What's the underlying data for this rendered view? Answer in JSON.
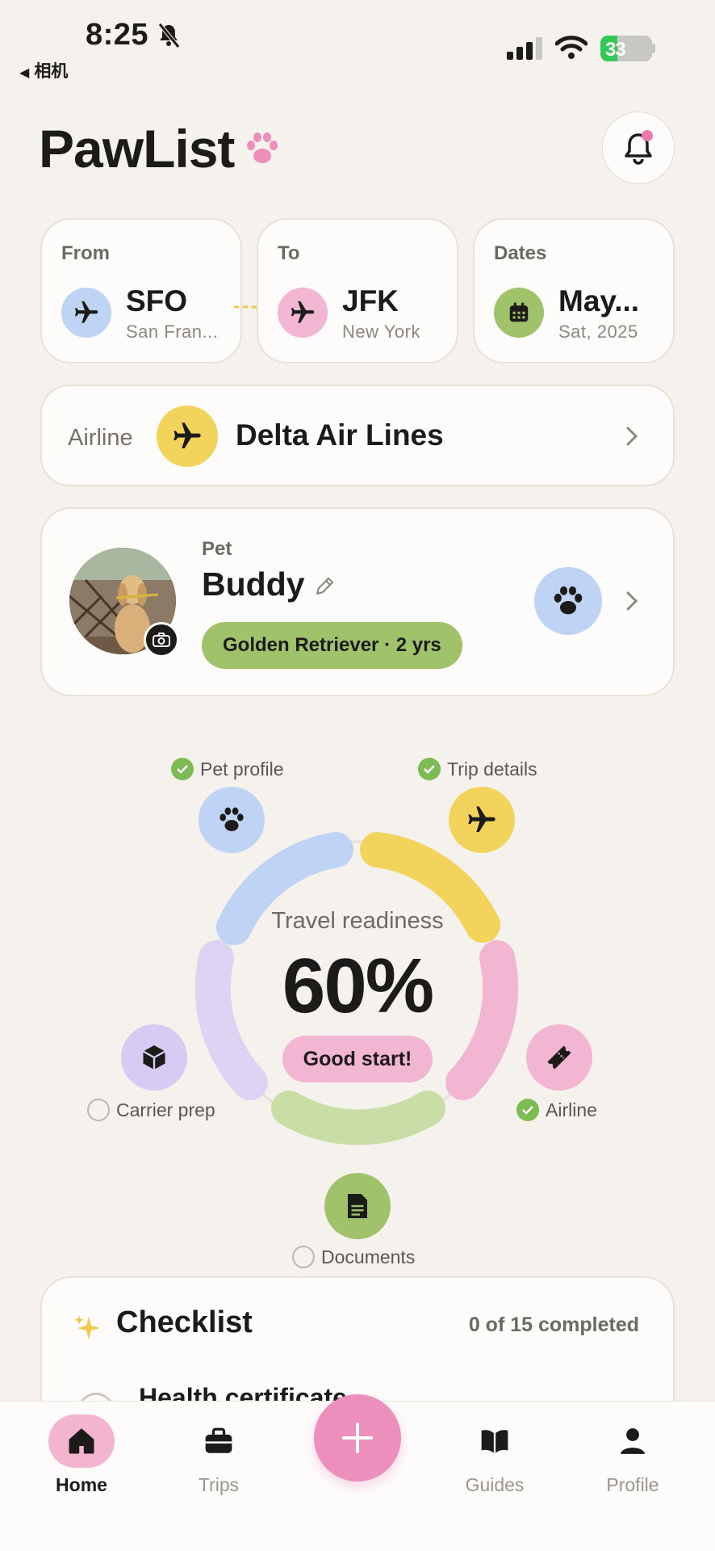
{
  "status_bar": {
    "time": "8:25",
    "back_label": "相机",
    "battery": "33"
  },
  "header": {
    "title": "PawList"
  },
  "route": {
    "from": {
      "label": "From",
      "code": "SFO",
      "city": "San Fran..."
    },
    "to": {
      "label": "To",
      "code": "JFK",
      "city": "New York"
    },
    "dates": {
      "label": "Dates",
      "value": "May...",
      "sub": "Sat, 2025"
    }
  },
  "airline": {
    "label": "Airline",
    "name": "Delta Air Lines"
  },
  "pet": {
    "label": "Pet",
    "name": "Buddy",
    "breed": "Golden Retriever · 2 yrs"
  },
  "readiness": {
    "title": "Travel readiness",
    "percent": "60%",
    "status": "Good start!",
    "steps": [
      {
        "label": "Pet profile",
        "done": true
      },
      {
        "label": "Trip details",
        "done": true
      },
      {
        "label": "Airline",
        "done": true
      },
      {
        "label": "Documents",
        "done": false
      },
      {
        "label": "Carrier prep",
        "done": false
      }
    ]
  },
  "checklist": {
    "title": "Checklist",
    "count": "0 of 15 completed",
    "first_item": "Health certificate"
  },
  "tabs": [
    {
      "label": "Home",
      "icon": "home-icon",
      "active": true
    },
    {
      "label": "Trips",
      "icon": "briefcase-icon",
      "active": false
    },
    {
      "label": "Guides",
      "icon": "book-icon",
      "active": false
    },
    {
      "label": "Profile",
      "icon": "person-icon",
      "active": false
    }
  ],
  "colors": {
    "blue": "#bfd3f5",
    "yellow": "#f2d35b",
    "pink": "#f2b6d2",
    "green": "#9fc26a",
    "purple": "#d6cbf2",
    "fab": "#ec8fbd"
  }
}
